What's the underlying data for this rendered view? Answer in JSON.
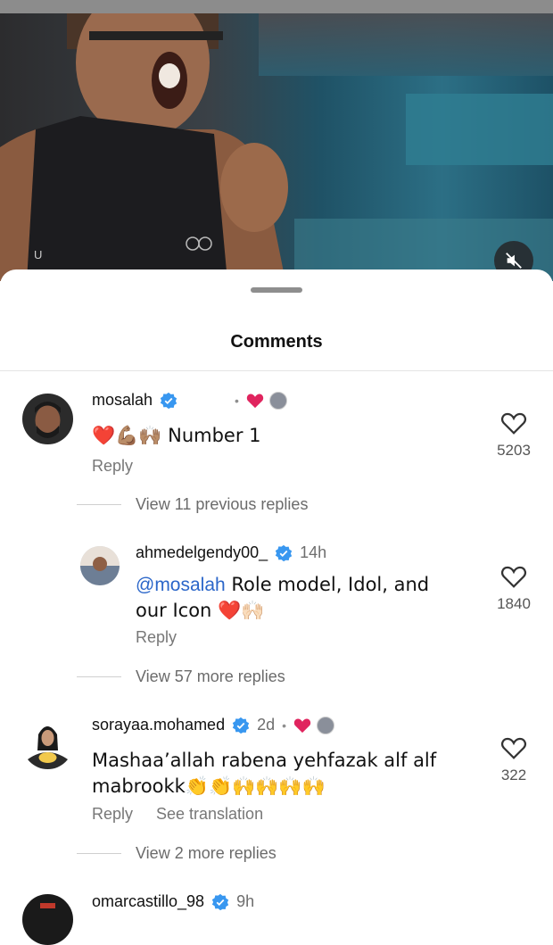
{
  "sheet": {
    "title": "Comments"
  },
  "comments": [
    {
      "username": "mosalah",
      "time": "",
      "text": "❤️💪🏽🙌🏽 Number 1",
      "reply_label": "Reply",
      "likes": "5203",
      "view_replies": "View 11 previous replies"
    },
    {
      "username": "ahmedelgendy00_",
      "time": "14h",
      "mention": "@mosalah",
      "text": " Role model, Idol, and our Icon ❤️🙌🏻",
      "reply_label": "Reply",
      "likes": "1840",
      "view_replies": "View 57 more replies"
    },
    {
      "username": "sorayaa.mohamed",
      "time": "2d",
      "text": "Mashaa’allah rabena yehfazak alf alf mabrookk👏👏🙌🙌🙌🙌",
      "reply_label": "Reply",
      "translate_label": "See translation",
      "likes": "322",
      "view_replies": "View 2 more replies"
    },
    {
      "username": "omarcastillo_98",
      "time": "9h"
    }
  ],
  "icons": {
    "mute": "speaker-muted-icon",
    "like": "heart-outline-icon",
    "verified": "verified-badge-icon"
  },
  "colors": {
    "verified": "#3897f0",
    "mention": "#2b66c9",
    "heart": "#e0245e"
  }
}
